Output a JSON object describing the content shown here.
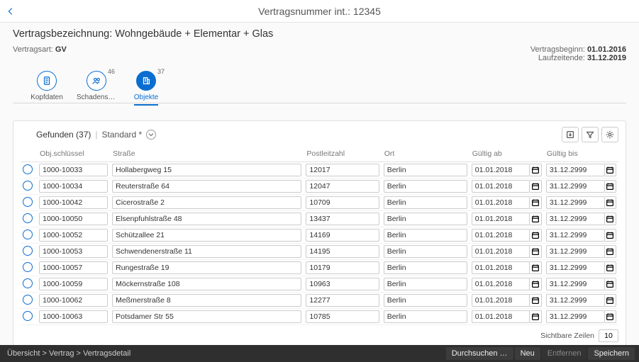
{
  "header": {
    "title": "Vertragsnummer int.: 12345"
  },
  "sub": {
    "title": "Vertragsbezeichnung: Wohngebäude + Elementar + Glas",
    "art_label": "Vertragsart:",
    "art_value": "GV",
    "beginn_label": "Vertragsbeginn:",
    "beginn_value": "01.01.2016",
    "ende_label": "Laufzeitende:",
    "ende_value": "31.12.2019"
  },
  "tabs": {
    "kopfdaten": {
      "label": "Kopfdaten"
    },
    "schaden": {
      "label": "Schadensco…",
      "badge": "46"
    },
    "objekte": {
      "label": "Objekte",
      "badge": "37"
    }
  },
  "table": {
    "found_label": "Gefunden (37)",
    "standard_label": "Standard *",
    "visible_label": "Sichtbare Zeilen",
    "visible_value": "10",
    "headers": {
      "key": "Obj.schlüssel",
      "str": "Straße",
      "plz": "Postleitzahl",
      "ort": "Ort",
      "ab": "Gültig ab",
      "bis": "Gültig bis"
    },
    "rows": [
      {
        "key": "1000-10033",
        "str": "Hollabergweg 15",
        "plz": "12017",
        "ort": "Berlin",
        "ab": "01.01.2018",
        "bis": "31.12.2999"
      },
      {
        "key": "1000-10034",
        "str": "Reuterstraße 64",
        "plz": "12047",
        "ort": "Berlin",
        "ab": "01.01.2018",
        "bis": "31.12.2999"
      },
      {
        "key": "1000-10042",
        "str": "Cicerostraße 2",
        "plz": "10709",
        "ort": "Berlin",
        "ab": "01.01.2018",
        "bis": "31.12.2999"
      },
      {
        "key": "1000-10050",
        "str": "Elsenpfuhlstraße 48",
        "plz": "13437",
        "ort": "Berlin",
        "ab": "01.01.2018",
        "bis": "31.12.2999"
      },
      {
        "key": "1000-10052",
        "str": "Schützallee 21",
        "plz": "14169",
        "ort": "Berlin",
        "ab": "01.01.2018",
        "bis": "31.12.2999"
      },
      {
        "key": "1000-10053",
        "str": "Schwendenerstraße 11",
        "plz": "14195",
        "ort": "Berlin",
        "ab": "01.01.2018",
        "bis": "31.12.2999"
      },
      {
        "key": "1000-10057",
        "str": "Rungestraße 19",
        "plz": "10179",
        "ort": "Berlin",
        "ab": "01.01.2018",
        "bis": "31.12.2999"
      },
      {
        "key": "1000-10059",
        "str": "Möckernstraße 108",
        "plz": "10963",
        "ort": "Berlin",
        "ab": "01.01.2018",
        "bis": "31.12.2999"
      },
      {
        "key": "1000-10062",
        "str": "Meßmerstraße 8",
        "plz": "12277",
        "ort": "Berlin",
        "ab": "01.01.2018",
        "bis": "31.12.2999"
      },
      {
        "key": "1000-10063",
        "str": "Potsdamer Str 55",
        "plz": "10785",
        "ort": "Berlin",
        "ab": "01.01.2018",
        "bis": "31.12.2999"
      }
    ]
  },
  "footer": {
    "breadcrumb": "Übersicht > Vertrag > Vertragsdetail",
    "browse": "Durchsuchen …",
    "new": "Neu",
    "remove": "Entfernen",
    "save": "Speichern"
  }
}
